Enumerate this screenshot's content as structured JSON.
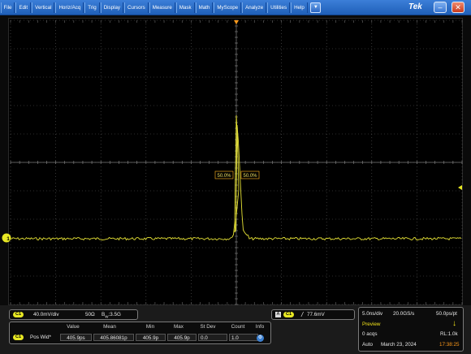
{
  "menu": {
    "items": [
      "File",
      "Edit",
      "Vertical",
      "Horiz/Acq",
      "Trig",
      "Display",
      "Cursors",
      "Measure",
      "Mask",
      "Math",
      "MyScope",
      "Analyze",
      "Utilities",
      "Help"
    ],
    "brand": "Tek"
  },
  "waveform": {
    "trace_color": "#e6e235",
    "ref_label_left": "50.0%",
    "ref_label_right": "50.0%",
    "channel_marker": "1"
  },
  "channel": {
    "badge": "C1",
    "scale": "40.0mV/div",
    "impedance": "50Ω",
    "bw_label": "B",
    "bw_sub": "W",
    "bw_value": ":3.5G"
  },
  "measurement": {
    "headers": [
      "Value",
      "Mean",
      "Min",
      "Max",
      "St Dev",
      "Count",
      "Info"
    ],
    "badge": "C1",
    "name": "Pos Wid*",
    "value": "405.9ps",
    "mean": "405.86081p",
    "min": "405.9p",
    "max": "405.9p",
    "stdev": "0.0",
    "count": "1.0"
  },
  "trigger": {
    "mode": "A",
    "badge": "C1",
    "slope": "/",
    "level": "77.6mV"
  },
  "timebase": {
    "scale": "5.0ns/div",
    "sample_rate": "20.0GS/s",
    "resolution": "50.0ps/pt",
    "mode": "Preview",
    "acqs": "0 acqs",
    "record_length": "RL:1.0k",
    "run_mode": "Auto",
    "date": "March 23, 2024",
    "time": "17:38:25"
  },
  "colors": {
    "accent": "#e8e824",
    "menubar": "#2a6cc8",
    "graticule": "#5a5a5a",
    "time_highlight": "#ff9a1a",
    "preview_highlight": "#f2e21a"
  }
}
